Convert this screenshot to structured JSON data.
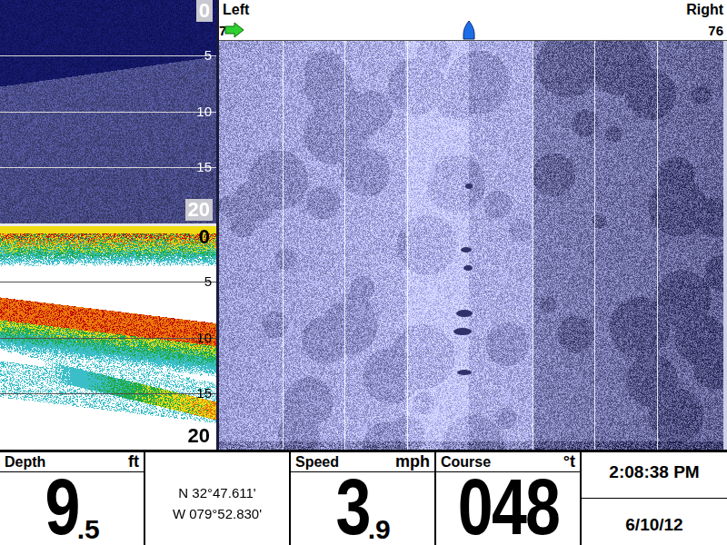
{
  "down_imaging": {
    "depth_ticks": [
      "0",
      "5",
      "10",
      "15",
      "20"
    ]
  },
  "sonar_2d": {
    "depth_ticks": [
      "0",
      "5",
      "10",
      "15",
      "20"
    ]
  },
  "side_imaging": {
    "left_label": "Left",
    "right_label": "Right",
    "left_range": "7",
    "right_range": "76"
  },
  "readouts": {
    "depth": {
      "label": "Depth",
      "unit": "ft",
      "whole": "9",
      "fraction": ".5"
    },
    "position": {
      "latitude": "N 32°47.611'",
      "longitude": "W 079°52.830'"
    },
    "speed": {
      "label": "Speed",
      "unit": "mph",
      "whole": "3",
      "fraction": ".9"
    },
    "course": {
      "label": "Course",
      "unit": "°t",
      "value": "048"
    },
    "time": "2:08:38 PM",
    "date": "6/10/12"
  }
}
